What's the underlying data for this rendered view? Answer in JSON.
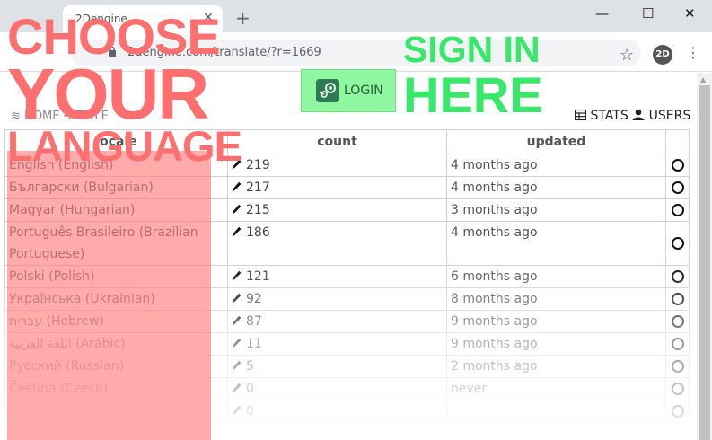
{
  "browser": {
    "tab_title": "2Dengine",
    "tab_close": "✕",
    "new_tab": "+",
    "url": "2dengine.com/translate/?r=1669",
    "avatar": "2D",
    "minimize": "—",
    "maximize": "☐",
    "close": "✕",
    "star": "☆",
    "menu": "⋮"
  },
  "promo": {
    "left_line1": "CHOOSE",
    "left_line2": "YOUR",
    "left_line3": "LANGUAGE",
    "right_line1": "SIGN IN",
    "right_line2": "HERE"
  },
  "login": {
    "label": "LOGIN"
  },
  "breadcrumb": {
    "home": "HOME",
    "arrow": "➔",
    "title": "TITLE"
  },
  "nav": {
    "stats": "STATS",
    "users": "USERS"
  },
  "table": {
    "headers": [
      "locale",
      "count",
      "updated",
      ""
    ],
    "rows": [
      {
        "locale": "English (English)",
        "count": "219",
        "updated": "4 months ago"
      },
      {
        "locale": "Български (Bulgarian)",
        "count": "217",
        "updated": "4 months ago"
      },
      {
        "locale": "Magyar (Hungarian)",
        "count": "215",
        "updated": "3 months ago"
      },
      {
        "locale": "Português Brasileiro (Brazilian Portuguese)",
        "count": "186",
        "updated": "4 months ago"
      },
      {
        "locale": "Polski (Polish)",
        "count": "121",
        "updated": "6 months ago"
      },
      {
        "locale": "Українська (Ukrainian)",
        "count": "92",
        "updated": "8 months ago"
      },
      {
        "locale": "עברית (Hebrew)",
        "count": "87",
        "updated": "9 months ago"
      },
      {
        "locale": "اللغة العربية (Arabic)",
        "count": "11",
        "updated": "9 months ago"
      },
      {
        "locale": "Русский (Russian)",
        "count": "5",
        "updated": "2 months ago"
      },
      {
        "locale": "Čeština (Czech)",
        "count": "0",
        "updated": "never"
      },
      {
        "locale": "",
        "count": "0",
        "updated": ""
      }
    ]
  },
  "colors": {
    "promo_left": "#ff6f6f",
    "promo_right": "#39e86a",
    "login_bg": "#8ff79f"
  }
}
